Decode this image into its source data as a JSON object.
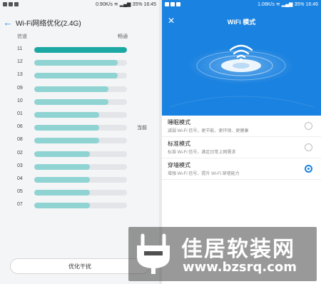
{
  "left": {
    "status": {
      "speed": "0.90K/s",
      "battery": "35%",
      "time": "16:45"
    },
    "title": "Wi-Fi网络优化(2.4G)",
    "back_icon": "arrow-left-icon",
    "columns": {
      "channel": "信道",
      "quality": "畅通"
    },
    "channels": [
      {
        "ch": "11",
        "level": 1.0,
        "best": true
      },
      {
        "ch": "12",
        "level": 0.9
      },
      {
        "ch": "13",
        "level": 0.9
      },
      {
        "ch": "09",
        "level": 0.8
      },
      {
        "ch": "10",
        "level": 0.8
      },
      {
        "ch": "01",
        "level": 0.7
      },
      {
        "ch": "06",
        "level": 0.7,
        "current_label": "当前"
      },
      {
        "ch": "08",
        "level": 0.7
      },
      {
        "ch": "02",
        "level": 0.6
      },
      {
        "ch": "03",
        "level": 0.6
      },
      {
        "ch": "04",
        "level": 0.6
      },
      {
        "ch": "05",
        "level": 0.6
      },
      {
        "ch": "07",
        "level": 0.6
      }
    ],
    "optimize_button": "优化干扰"
  },
  "right": {
    "status": {
      "speed": "1.08K/s",
      "battery": "35%",
      "time": "16:46"
    },
    "title": "WiFi 模式",
    "close_icon": "close-icon",
    "hero_icon": "wifi-icon",
    "modes": [
      {
        "name": "睡眠模式",
        "desc": "减弱 Wi-Fi 信号，更节能、更环保、更健康",
        "selected": false
      },
      {
        "name": "标准模式",
        "desc": "标准 Wi-Fi 信号，满足日常上网需求",
        "selected": false
      },
      {
        "name": "穿墙模式",
        "desc": "增强 Wi-Fi 信号，提升 Wi-Fi 穿墙能力",
        "selected": true
      }
    ]
  },
  "watermark": {
    "title": "佳居软装网",
    "url": "www.bzsrq.com"
  },
  "colors": {
    "accent": "#1a82e0",
    "best_bar": "#1ba8a3",
    "bar": "#8fd3d3"
  }
}
